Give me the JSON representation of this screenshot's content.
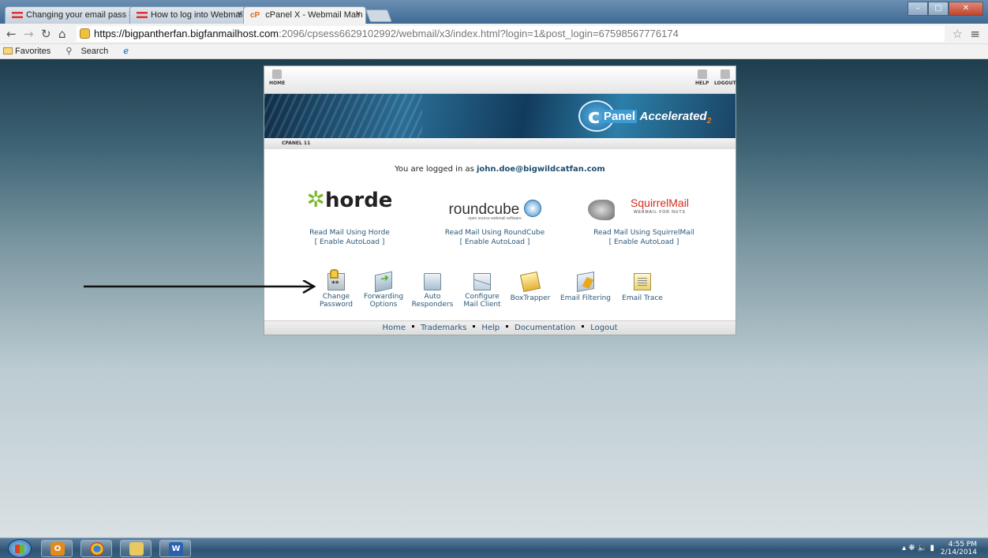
{
  "browser": {
    "tabs": [
      {
        "title": "Changing your email pass",
        "favicon": "red-stripes-icon",
        "active": false
      },
      {
        "title": "How to log into Webmail",
        "favicon": "red-stripes-icon",
        "active": false
      },
      {
        "title": "cPanel X - Webmail Main",
        "favicon": "cpanel-icon",
        "active": true
      }
    ],
    "tab_close": "×",
    "url": {
      "host": "https://bigpantherfan.bigfanmailhost.com",
      "path": ":2096/cpsess6629102992/webmail/x3/index.html?login=1&post_login=67598567776174"
    },
    "bookmarks": [
      "Favorites",
      "Search"
    ]
  },
  "webmail": {
    "top_nav": {
      "home": "HOME",
      "help": "HELP",
      "logout": "LOGOUT"
    },
    "brand": {
      "c": "c",
      "panel": "Panel",
      "accelerated": "Accelerated",
      "sub": "2"
    },
    "crumb": "CPANEL 11",
    "logged_in_prefix": "You are logged in as",
    "user": "john.doe@bigwildcatfan.com",
    "clients": [
      {
        "logo_text": "horde",
        "read": "Read Mail Using Horde",
        "autoload": "[ Enable AutoLoad ]"
      },
      {
        "logo_text": "roundcube",
        "tagline": "open source webmail software",
        "read": "Read Mail Using RoundCube",
        "autoload": "[ Enable AutoLoad ]"
      },
      {
        "logo_text": "SquirrelMail",
        "tagline": "WEBMAIL FOR NUTS",
        "read": "Read Mail Using SquirrelMail",
        "autoload": "[ Enable AutoLoad ]"
      }
    ],
    "tools": [
      {
        "line1": "Change",
        "line2": "Password",
        "icon": "lock-icon"
      },
      {
        "line1": "Forwarding",
        "line2": "Options",
        "icon": "forward-mail-icon"
      },
      {
        "line1": "Auto",
        "line2": "Responders",
        "icon": "auto-responder-icon"
      },
      {
        "line1": "Configure",
        "line2": "Mail Client",
        "icon": "envelope-icon"
      },
      {
        "line1": "BoxTrapper",
        "line2": "",
        "icon": "boxtrapper-icon"
      },
      {
        "line1": "Email Filtering",
        "line2": "",
        "icon": "filter-icon"
      },
      {
        "line1": "Email Trace",
        "line2": "",
        "icon": "trace-icon"
      }
    ],
    "footer": [
      "Home",
      "Trademarks",
      "Help",
      "Documentation",
      "Logout"
    ]
  },
  "taskbar": {
    "time": "4:55 PM",
    "date": "2/14/2014"
  }
}
